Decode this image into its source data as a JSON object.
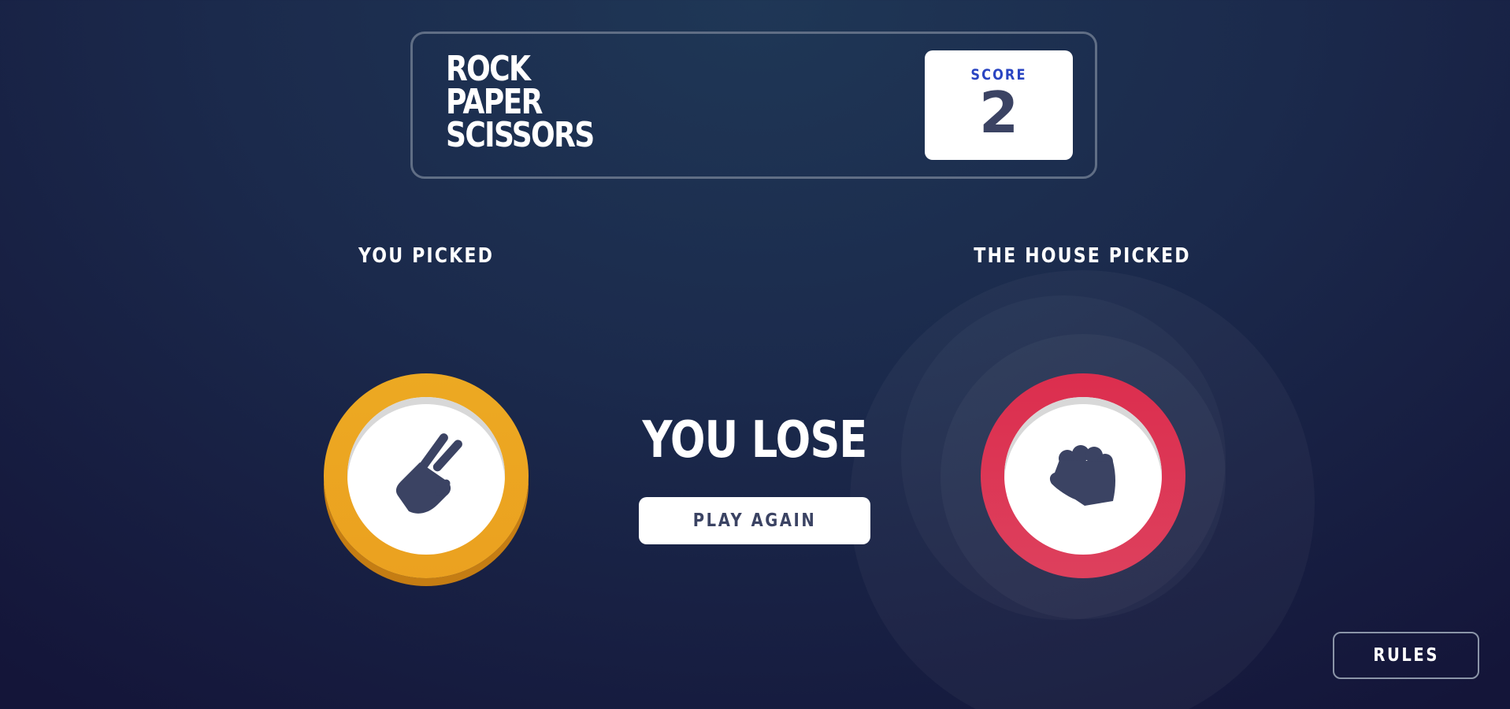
{
  "header": {
    "title_lines": [
      "ROCK",
      "PAPER",
      "SCISSORS"
    ],
    "score_label": "SCORE",
    "score_value": "2"
  },
  "game": {
    "player_label": "YOU PICKED",
    "house_label": "THE HOUSE PICKED",
    "player_choice": {
      "name": "scissors",
      "icon": "scissors-hand-icon",
      "color": "#eca922"
    },
    "house_choice": {
      "name": "rock",
      "icon": "rock-fist-icon",
      "color": "#dc2e4e"
    },
    "result_text": "YOU LOSE",
    "play_again_label": "PLAY AGAIN"
  },
  "footer": {
    "rules_label": "RULES"
  },
  "colors": {
    "background_top": "#1f3756",
    "background_bottom": "#141539",
    "header_outline": "#606e85",
    "score_text": "#3b4363",
    "score_label": "#2a45c2"
  }
}
